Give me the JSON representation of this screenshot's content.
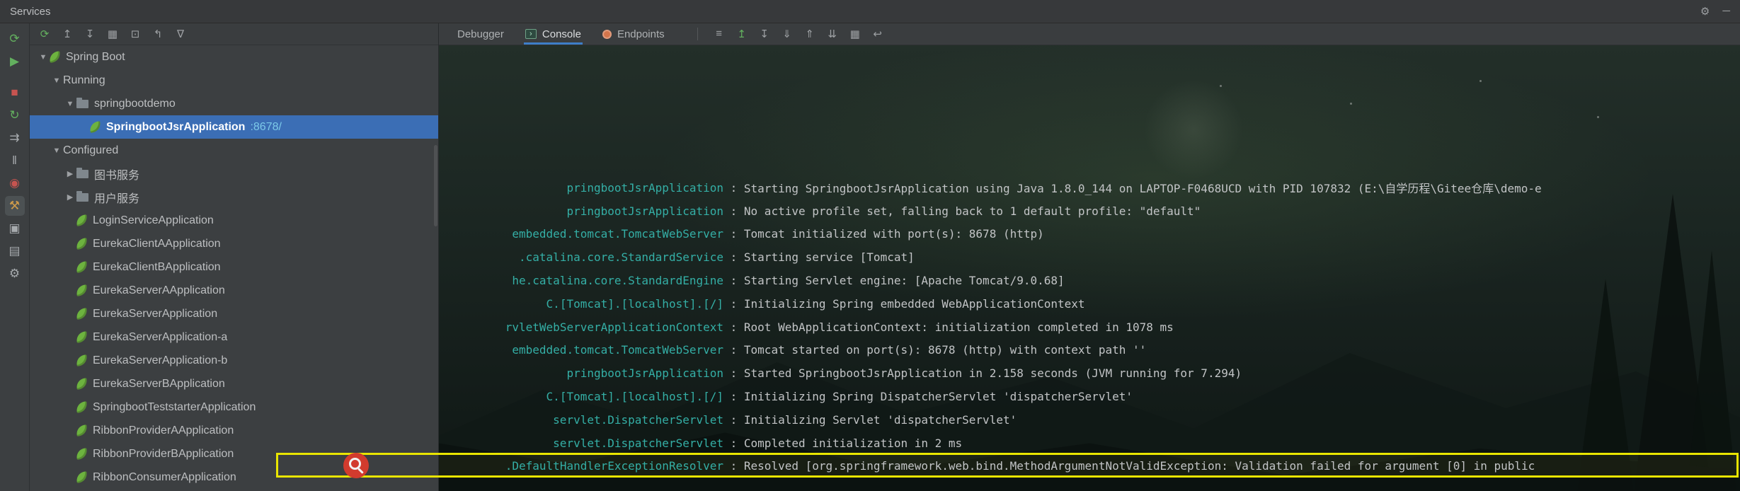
{
  "window": {
    "title": "Services"
  },
  "titlebar_icons": [
    {
      "name": "tool-window-options-icon",
      "glyph": "⚙"
    },
    {
      "name": "hide-icon",
      "glyph": "─"
    }
  ],
  "left_toolbar": [
    {
      "name": "rerun-icon",
      "glyph": "⟳",
      "color": "#63B05F"
    },
    {
      "name": "debug-icon",
      "glyph": "▶",
      "color": "#63B05F"
    },
    {
      "name": "stop-icon",
      "glyph": "■",
      "color": "#C75450",
      "gap_before": true
    },
    {
      "name": "restart-icon",
      "glyph": "↻",
      "color": "#63B05F"
    },
    {
      "name": "resume-icon",
      "glyph": "⇉",
      "color": "#A7ABAE"
    },
    {
      "name": "pause-icon",
      "glyph": "‖",
      "color": "#A7ABAE"
    },
    {
      "name": "breakpoints-icon",
      "glyph": "◉",
      "color": "#C75450"
    },
    {
      "name": "edit-configuration-icon",
      "glyph": "⚒",
      "color": "#CE9A4A",
      "highlighted": true
    },
    {
      "name": "thread-dump-icon",
      "glyph": "▣",
      "color": "#A7ABAE"
    },
    {
      "name": "layout-icon",
      "glyph": "▤",
      "color": "#A7ABAE"
    },
    {
      "name": "settings-icon",
      "glyph": "⚙",
      "color": "#A7ABAE"
    }
  ],
  "tree": {
    "toolbar": [
      {
        "name": "refresh-icon",
        "glyph": "⟳",
        "color": "#63B05F"
      },
      {
        "name": "expand-all-icon",
        "glyph": "↥",
        "color": "#9DA0A3"
      },
      {
        "name": "collapse-all-icon",
        "glyph": "↧",
        "color": "#9DA0A3"
      },
      {
        "name": "group-icon",
        "glyph": "▦",
        "color": "#9DA0A3"
      },
      {
        "name": "view-options-icon",
        "glyph": "⊡",
        "color": "#9DA0A3"
      },
      {
        "name": "previous-icon",
        "glyph": "↰",
        "color": "#9DA0A3"
      },
      {
        "name": "filter-icon",
        "glyph": "∇",
        "color": "#9DA0A3"
      }
    ],
    "items": [
      {
        "label": "Spring Boot",
        "depth": 0,
        "arrow": "▼",
        "icon": "spring-leaf"
      },
      {
        "label": "Running",
        "depth": 1,
        "arrow": "▼",
        "icon": null
      },
      {
        "label": "springbootdemo",
        "depth": 2,
        "arrow": "▼",
        "icon": "folder"
      },
      {
        "label": "SpringbootJsrApplication",
        "suffix": ":8678/",
        "depth": 3,
        "arrow": null,
        "icon": "spring-leaf",
        "selected": true
      },
      {
        "label": "Configured",
        "depth": 1,
        "arrow": "▼",
        "icon": null
      },
      {
        "label": "图书服务",
        "depth": 2,
        "arrow": "▶",
        "icon": "folder"
      },
      {
        "label": "用户服务",
        "depth": 2,
        "arrow": "▶",
        "icon": "folder"
      },
      {
        "label": "LoginServiceApplication",
        "depth": 2,
        "arrow": null,
        "icon": "spring-leaf"
      },
      {
        "label": "EurekaClientAApplication",
        "depth": 2,
        "arrow": null,
        "icon": "spring-leaf"
      },
      {
        "label": "EurekaClientBApplication",
        "depth": 2,
        "arrow": null,
        "icon": "spring-leaf"
      },
      {
        "label": "EurekaServerAApplication",
        "depth": 2,
        "arrow": null,
        "icon": "spring-leaf"
      },
      {
        "label": "EurekaServerApplication",
        "depth": 2,
        "arrow": null,
        "icon": "spring-leaf"
      },
      {
        "label": "EurekaServerApplication-a",
        "depth": 2,
        "arrow": null,
        "icon": "spring-leaf"
      },
      {
        "label": "EurekaServerApplication-b",
        "depth": 2,
        "arrow": null,
        "icon": "spring-leaf"
      },
      {
        "label": "EurekaServerBApplication",
        "depth": 2,
        "arrow": null,
        "icon": "spring-leaf"
      },
      {
        "label": "SpringbootTeststarterApplication",
        "depth": 2,
        "arrow": null,
        "icon": "spring-leaf"
      },
      {
        "label": "RibbonProviderAApplication",
        "depth": 2,
        "arrow": null,
        "icon": "spring-leaf"
      },
      {
        "label": "RibbonProviderBApplication",
        "depth": 2,
        "arrow": null,
        "icon": "spring-leaf"
      },
      {
        "label": "RibbonConsumerApplication",
        "depth": 2,
        "arrow": null,
        "icon": "spring-leaf"
      }
    ]
  },
  "console": {
    "tabs": [
      {
        "label": "Debugger",
        "selected": false
      },
      {
        "label": "Console",
        "icon": "console-icon",
        "icon_glyph": "›",
        "selected": true
      },
      {
        "label": "Endpoints",
        "icon": "endpoints-icon",
        "icon_glyph": "",
        "selected": false
      }
    ],
    "toolbar": [
      {
        "name": "settings-menu-icon",
        "glyph": "≡",
        "color": "#9DA0A3"
      },
      {
        "name": "up-stack-trace-icon",
        "glyph": "↥",
        "color": "#63B05F"
      },
      {
        "name": "down-stack-trace-icon",
        "glyph": "↧",
        "color": "#9DA0A3"
      },
      {
        "name": "scroll-to-end-icon",
        "glyph": "⇓",
        "color": "#9DA0A3"
      },
      {
        "name": "scroll-to-top-icon",
        "glyph": "⇑",
        "color": "#9DA0A3"
      },
      {
        "name": "clear-console-icon",
        "glyph": "⇊",
        "color": "#9DA0A3"
      },
      {
        "name": "print-icon",
        "glyph": "▦",
        "color": "#9DA0A3"
      },
      {
        "name": "soft-wrap-icon",
        "glyph": "↩",
        "color": "#9DA0A3"
      }
    ],
    "separator": " : ",
    "log": [
      {
        "logger": "pringbootJsrApplication",
        "message": "Starting SpringbootJsrApplication using Java 1.8.0_144 on LAPTOP-F0468UCD with PID 107832 (E:\\自学历程\\Gitee仓库\\demo-e"
      },
      {
        "logger": "pringbootJsrApplication",
        "message": "No active profile set, falling back to 1 default profile: \"default\""
      },
      {
        "logger": "embedded.tomcat.TomcatWebServer",
        "message": "Tomcat initialized with port(s): 8678 (http)"
      },
      {
        "logger": ".catalina.core.StandardService",
        "message": "Starting service [Tomcat]"
      },
      {
        "logger": "he.catalina.core.StandardEngine",
        "message": "Starting Servlet engine: [Apache Tomcat/9.0.68]"
      },
      {
        "logger": "C.[Tomcat].[localhost].[/]",
        "message": "Initializing Spring embedded WebApplicationContext"
      },
      {
        "logger": "rvletWebServerApplicationContext",
        "message": "Root WebApplicationContext: initialization completed in 1078 ms"
      },
      {
        "logger": "embedded.tomcat.TomcatWebServer",
        "message": "Tomcat started on port(s): 8678 (http) with context path ''"
      },
      {
        "logger": "pringbootJsrApplication",
        "message": "Started SpringbootJsrApplication in 2.158 seconds (JVM running for 7.294)"
      },
      {
        "logger": "C.[Tomcat].[localhost].[/]",
        "message": "Initializing Spring DispatcherServlet 'dispatcherServlet'"
      },
      {
        "logger": "servlet.DispatcherServlet",
        "message": "Initializing Servlet 'dispatcherServlet'"
      },
      {
        "logger": "servlet.DispatcherServlet",
        "message": "Completed initialization in 2 ms"
      },
      {
        "logger": ".DefaultHandlerExceptionResolver",
        "message": "Resolved [org.springframework.web.bind.MethodArgumentNotValidException: Validation failed for argument [0] in public",
        "highlighted": true
      }
    ]
  },
  "annotation": {
    "highlight_color": "#E9E500",
    "marker_color": "#D23B2E",
    "marker": "magnifier"
  },
  "colors": {
    "panel": "#3C3F41",
    "selection": "#3B6EB5",
    "logger_text": "#34AFA6",
    "spring_green": "#6DB33F",
    "tab_underline": "#3E7EC8",
    "port_link": "#7CC9E8"
  }
}
